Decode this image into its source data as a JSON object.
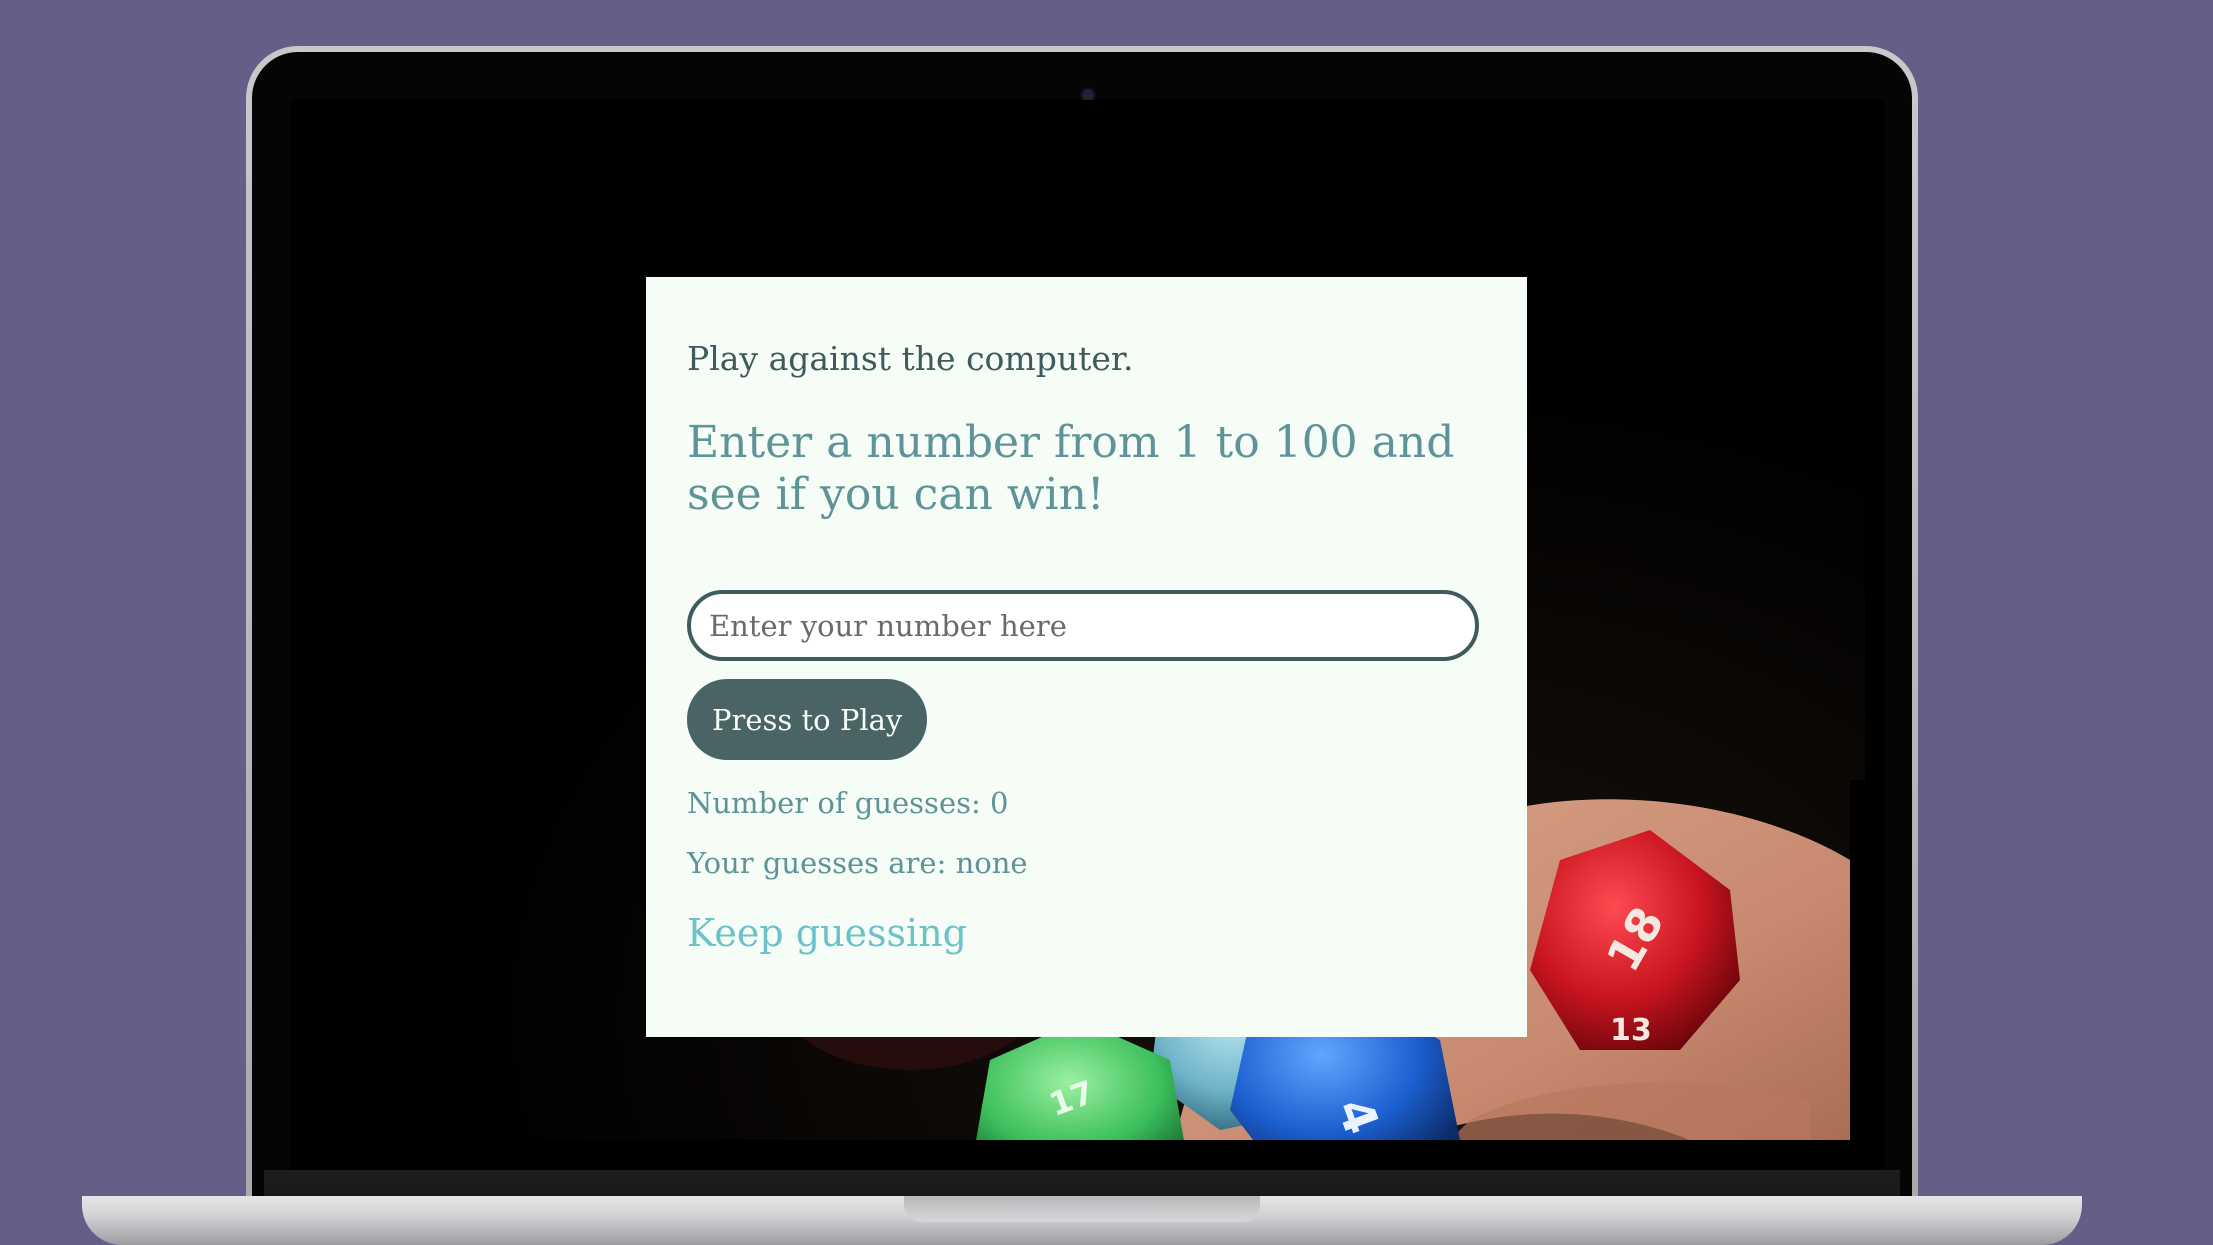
{
  "game": {
    "intro": "Play against the computer.",
    "headline": "Enter a number from 1 to 100 and see if you can win!",
    "input_placeholder": "Enter your number here",
    "input_value": "",
    "play_button_label": "Press to Play",
    "guess_count_text": "Number of guesses: 0",
    "guess_list_text": "Your guesses are: none",
    "status_text": "Keep guessing"
  },
  "colors": {
    "page_background": "#635f87",
    "card_background": "#f6fcf6",
    "button_background": "#4a6466",
    "headline": "#5e9497",
    "status": "#6bc2c9"
  },
  "icons": {
    "camera": "camera-icon",
    "background_image": "dice-photo"
  }
}
